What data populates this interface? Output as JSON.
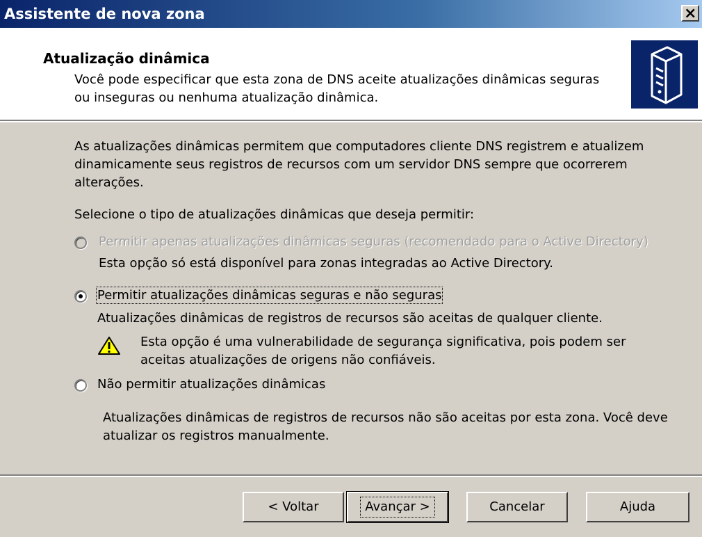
{
  "window": {
    "title": "Assistente de nova zona",
    "close_glyph": "×"
  },
  "header": {
    "title": "Atualização dinâmica",
    "description": "Você pode especificar que esta zona de DNS aceite atualizações dinâmicas seguras ou inseguras ou nenhuma atualização dinâmica.",
    "icon": "server-icon"
  },
  "body": {
    "intro": "As atualizações dinâmicas permitem que computadores cliente DNS registrem e atualizem dinamicamente seus registros de recursos com um servidor DNS sempre que ocorrerem alterações.",
    "select_label": "Selecione o tipo de atualizações dinâmicas que deseja permitir:",
    "options": [
      {
        "label": "Permitir apenas atualizações dinâmicas seguras (recomendado para o Active Directory)",
        "description": "Esta opção só está disponível para zonas integradas ao Active Directory.",
        "selected": false,
        "enabled": false
      },
      {
        "label": "Permitir atualizações dinâmicas seguras e não seguras",
        "description": "Atualizações dinâmicas de registros de recursos são aceitas de qualquer cliente.",
        "warning": "Esta opção é uma vulnerabilidade de segurança significativa, pois podem ser aceitas atualizações de origens não confiáveis.",
        "selected": true,
        "enabled": true
      },
      {
        "label": "Não permitir atualizações dinâmicas",
        "description": "Atualizações dinâmicas de registros de recursos não são aceitas por esta zona. Você deve atualizar os registros manualmente.",
        "selected": false,
        "enabled": true
      }
    ]
  },
  "buttons": {
    "back": "< Voltar",
    "next": "Avançar >",
    "cancel": "Cancelar",
    "help": "Ajuda"
  },
  "colors": {
    "title_bar": "#0a246a",
    "face": "#d4d0c8",
    "header_bg": "#ffffff",
    "warning": "#ffff00"
  }
}
